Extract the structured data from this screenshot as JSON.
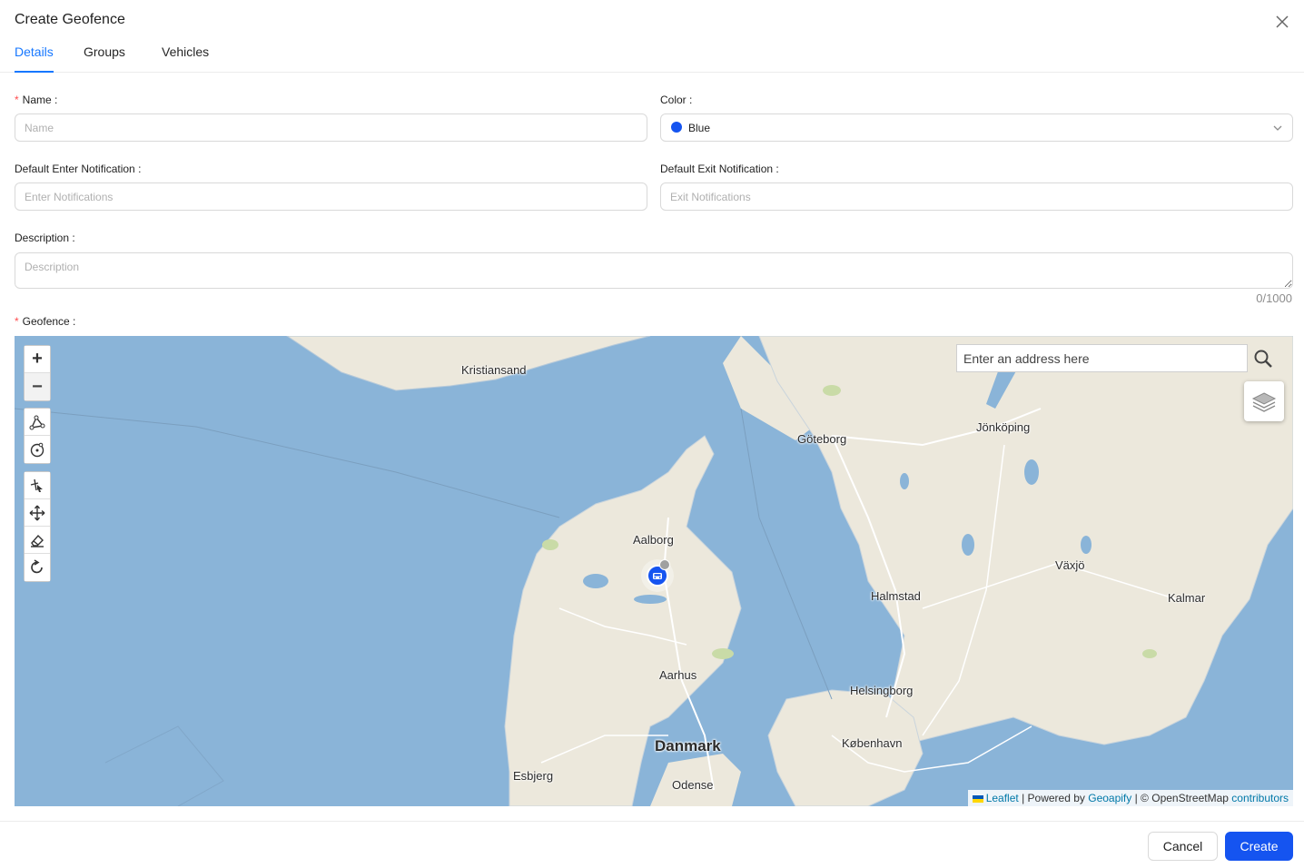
{
  "modal": {
    "title": "Create Geofence"
  },
  "tabs": [
    {
      "label": "Details",
      "active": true
    },
    {
      "label": "Groups",
      "active": false
    },
    {
      "label": "Vehicles",
      "active": false
    }
  ],
  "form": {
    "name": {
      "label": "Name",
      "placeholder": "Name",
      "required": true
    },
    "color": {
      "label": "Color",
      "value": "Blue",
      "swatch": "#1554f0"
    },
    "enter_notification": {
      "label": "Default Enter Notification",
      "placeholder": "Enter Notifications"
    },
    "exit_notification": {
      "label": "Default Exit Notification",
      "placeholder": "Exit Notifications"
    },
    "description": {
      "label": "Description",
      "placeholder": "Description",
      "counter": "0/1000"
    },
    "geofence": {
      "label": "Geofence",
      "required": true
    }
  },
  "map": {
    "search_placeholder": "Enter an address here",
    "cities": [
      {
        "name": "Kristiansand"
      },
      {
        "name": "Göteborg"
      },
      {
        "name": "Jönköping"
      },
      {
        "name": "Aalborg"
      },
      {
        "name": "Växjö"
      },
      {
        "name": "Halmstad"
      },
      {
        "name": "Kalmar"
      },
      {
        "name": "Aarhus"
      },
      {
        "name": "Helsingborg"
      },
      {
        "name": "Danmark"
      },
      {
        "name": "København"
      },
      {
        "name": "Esbjerg"
      },
      {
        "name": "Odense"
      }
    ],
    "attribution": {
      "leaflet": "Leaflet",
      "powered_by": "| Powered by",
      "geoapify": "Geoapify",
      "osm": "| © OpenStreetMap",
      "contributors": "contributors"
    },
    "zoom_in": "+",
    "zoom_out": "−",
    "icons": [
      "draw-polyline-icon",
      "draw-circle-icon",
      "edit-vertex-icon",
      "move-icon",
      "eraser-icon",
      "rotate-icon",
      "search-icon",
      "layers-icon",
      "vehicle-icon"
    ]
  },
  "footer": {
    "cancel_label": "Cancel",
    "create_label": "Create"
  },
  "colors": {
    "accent": "#1677ff",
    "primary_button": "#1554f0",
    "required": "#ff4d4f",
    "water": "#8ab4d8",
    "land": "#ece8dc"
  }
}
